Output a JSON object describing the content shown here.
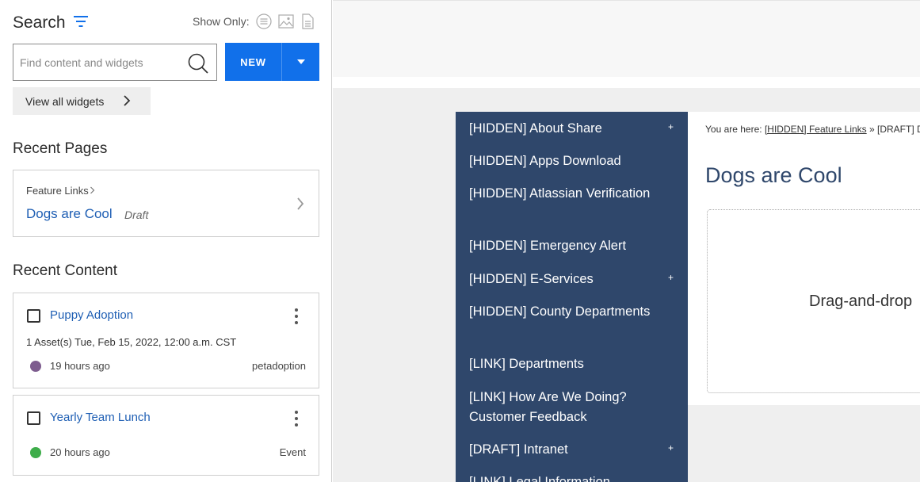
{
  "sidebar": {
    "search_title": "Search",
    "show_only_label": "Show Only:",
    "search_placeholder": "Find content and widgets",
    "new_label": "NEW",
    "view_all_label": "View all widgets",
    "accent_color": "#1170ea",
    "recent_pages_title": "Recent Pages",
    "recent_pages": [
      {
        "breadcrumb": "Feature Links",
        "title": "Dogs are Cool",
        "status": "Draft"
      }
    ],
    "recent_content_title": "Recent Content",
    "recent_content": [
      {
        "title": "Puppy Adoption",
        "meta": "1 Asset(s) Tue, Feb 15, 2022, 12:00 a.m. CST",
        "time_ago": "19 hours ago",
        "type": "petadoption",
        "dot_color": "#7d5c8e"
      },
      {
        "title": "Yearly Team Lunch",
        "time_ago": "20 hours ago",
        "type": "Event",
        "dot_color": "#3ead4a"
      }
    ]
  },
  "preview": {
    "nav_color": "#2f476b",
    "nav_items": [
      {
        "label": "[HIDDEN] About Share",
        "has_children": true,
        "plus": "+"
      },
      {
        "label": "[HIDDEN] Apps Download",
        "has_children": false
      },
      {
        "label": "[HIDDEN] Atlassian Verification",
        "has_children": false
      },
      {
        "label": "[HIDDEN] Emergency Alert",
        "has_children": false
      },
      {
        "label": "[HIDDEN] E-Services",
        "has_children": true,
        "plus": "+"
      },
      {
        "label": "[HIDDEN] County Departments",
        "has_children": false
      },
      {
        "label": "[LINK] Departments",
        "has_children": false
      },
      {
        "label": "[LINK] How Are We Doing? Customer Feedback",
        "has_children": false
      },
      {
        "label": "[DRAFT] Intranet",
        "has_children": true,
        "plus": "+"
      },
      {
        "label": "[LINK] Legal Information",
        "has_children": false
      }
    ],
    "breadcrumb_prefix": "You are here: ",
    "breadcrumb_link": "[HIDDEN] Feature Links",
    "breadcrumb_sep": " » ",
    "breadcrumb_current": "[DRAFT] Dogs",
    "page_heading": "Dogs are Cool",
    "dnd_text": "Drag-and-drop"
  }
}
